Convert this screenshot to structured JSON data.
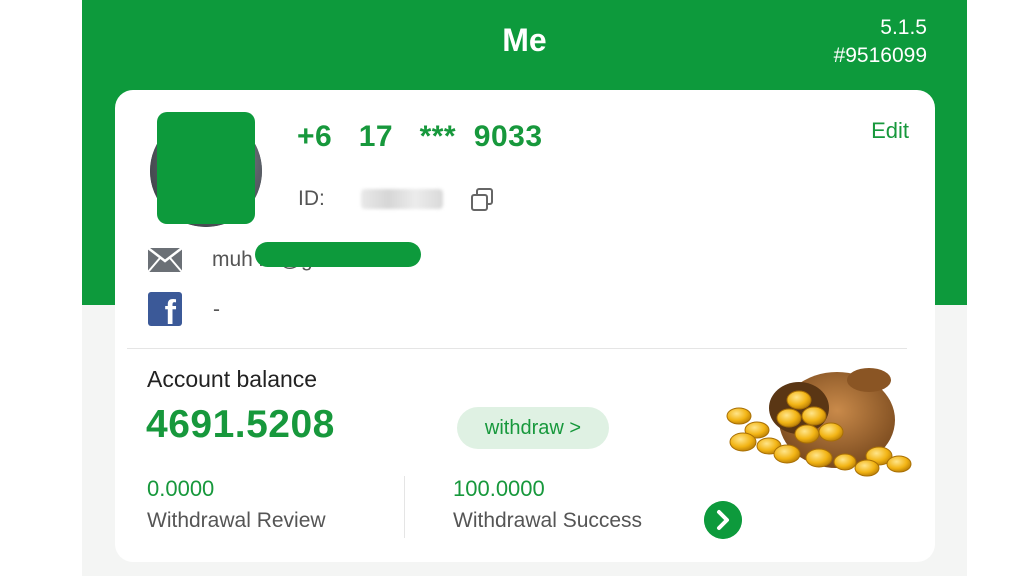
{
  "header": {
    "title": "Me",
    "version": "5.1.5",
    "build": "#9516099"
  },
  "profile": {
    "phone": "+6   17   ***  9033",
    "edit_label": "Edit",
    "id_label": "ID:",
    "email": "muh                         lid@gmail.com",
    "facebook": "-"
  },
  "balance": {
    "label": "Account balance",
    "value": "4691.5208",
    "withdraw_label": "withdraw >",
    "review_value": "0.0000",
    "review_label": "Withdrawal Review",
    "success_value": "100.0000",
    "success_label": "Withdrawal Success"
  },
  "icons": [
    "copy-icon",
    "mail-icon",
    "facebook-icon",
    "coin-bag-icon",
    "chevron-right-icon"
  ],
  "colors": {
    "brand_green": "#0d9a3c",
    "text_green": "#17983c",
    "pill_bg": "#dff1e3",
    "facebook_blue": "#3b5998"
  }
}
